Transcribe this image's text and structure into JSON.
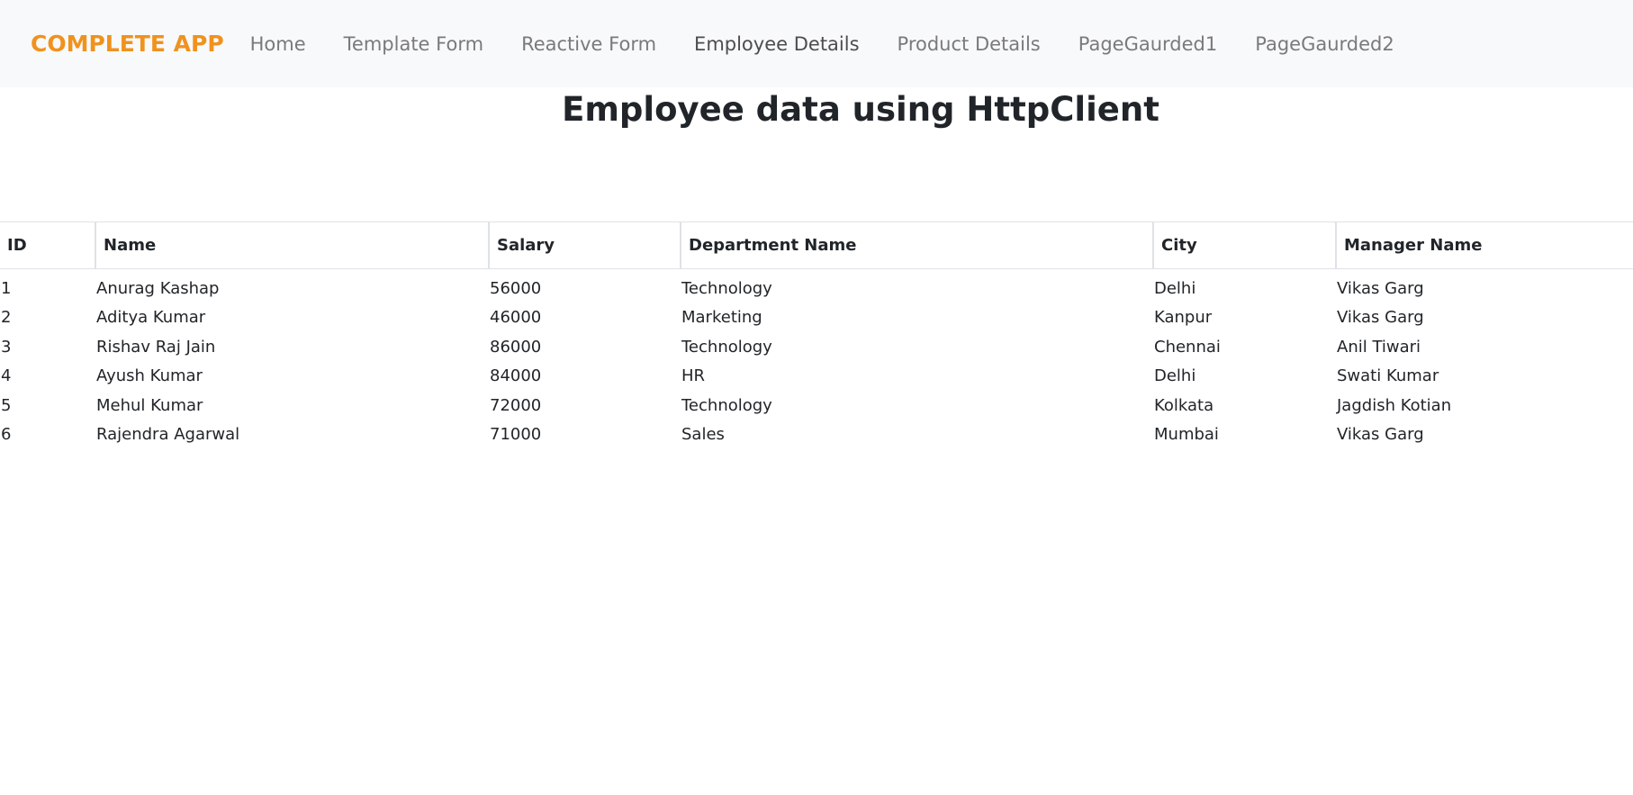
{
  "navbar": {
    "brand": "COMPLETE APP",
    "links": [
      {
        "label": "Home"
      },
      {
        "label": "Template Form"
      },
      {
        "label": "Reactive Form"
      },
      {
        "label": "Employee Details"
      },
      {
        "label": "Product Details"
      },
      {
        "label": "PageGaurded1"
      },
      {
        "label": "PageGaurded2"
      }
    ]
  },
  "page": {
    "title": "Employee data using HttpClient"
  },
  "table": {
    "headers": [
      "ID",
      "Name",
      "Salary",
      "Department Name",
      "City",
      "Manager Name"
    ],
    "rows": [
      [
        "1",
        "Anurag Kashap",
        "56000",
        "Technology",
        "Delhi",
        "Vikas Garg"
      ],
      [
        "2",
        "Aditya Kumar",
        "46000",
        "Marketing",
        "Kanpur",
        "Vikas Garg"
      ],
      [
        "3",
        "Rishav Raj Jain",
        "86000",
        "Technology",
        "Chennai",
        "Anil Tiwari"
      ],
      [
        "4",
        "Ayush Kumar",
        "84000",
        "HR",
        "Delhi",
        "Swati Kumar"
      ],
      [
        "5",
        "Mehul Kumar",
        "72000",
        "Technology",
        "Kolkata",
        "Jagdish Kotian"
      ],
      [
        "6",
        "Rajendra Agarwal",
        "71000",
        "Sales",
        "Mumbai",
        "Vikas Garg"
      ]
    ]
  },
  "colors": {
    "brand": "#f0921e",
    "navbar_bg": "#f8f9fa",
    "nav_link": "#7a7a7a",
    "nav_link_active": "#4d4d4d",
    "text": "#212529",
    "border": "#dee2e6"
  }
}
